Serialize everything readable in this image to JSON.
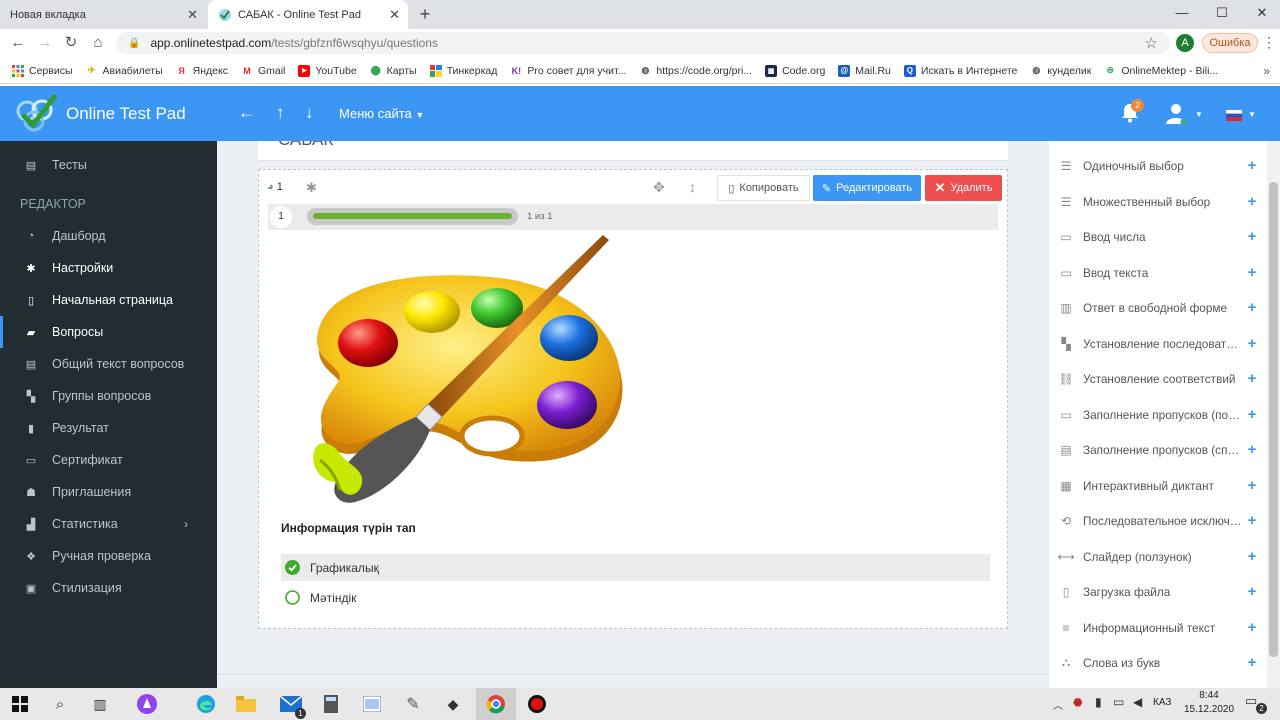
{
  "browser": {
    "tabs": [
      {
        "title": "Новая вкладка",
        "active": false
      },
      {
        "title": "САБАК - Online Test Pad",
        "active": true
      }
    ],
    "url_host": "app.onlinetestpad.com",
    "url_path": "/tests/gbfznf6wsqhyu/questions",
    "profile_initial": "A",
    "error_label": "Ошибка",
    "bookmarks": [
      {
        "label": "Сервисы",
        "icon": "apps-icon"
      },
      {
        "label": "Авиабилеты",
        "icon": "plane-icon"
      },
      {
        "label": "Яндекс",
        "icon": "yandex-icon"
      },
      {
        "label": "Gmail",
        "icon": "gmail-icon"
      },
      {
        "label": "YouTube",
        "icon": "youtube-icon"
      },
      {
        "label": "Карты",
        "icon": "maps-icon"
      },
      {
        "label": "Тинкеркад",
        "icon": "tinkercad-icon"
      },
      {
        "label": "Pro совет для учит...",
        "icon": "k-icon"
      },
      {
        "label": "https://code.org/pri...",
        "icon": "globe-icon"
      },
      {
        "label": "Code.org",
        "icon": "codeorg-icon"
      },
      {
        "label": "Mail.Ru",
        "icon": "mailru-icon"
      },
      {
        "label": "Искать в Интернете",
        "icon": "search-web-icon"
      },
      {
        "label": "кунделик",
        "icon": "globe-icon"
      },
      {
        "label": "OnlineMektep - Bili...",
        "icon": "onlinemektep-icon"
      }
    ]
  },
  "app": {
    "title": "Online Test Pad",
    "site_menu": "Меню сайта",
    "notifications_count": "2",
    "accent": "#3b96f4"
  },
  "sidebar": {
    "top_item": "Тесты",
    "section_label": "РЕДАКТОР",
    "items": [
      {
        "label": "Дашборд"
      },
      {
        "label": "Настройки"
      },
      {
        "label": "Начальная страница"
      },
      {
        "label": "Вопросы"
      },
      {
        "label": "Общий текст вопросов"
      },
      {
        "label": "Группы вопросов"
      },
      {
        "label": "Результат"
      },
      {
        "label": "Сертификат"
      },
      {
        "label": "Приглашения"
      },
      {
        "label": "Статистика"
      },
      {
        "label": "Ручная проверка"
      },
      {
        "label": "Стилизация"
      }
    ]
  },
  "main": {
    "test_title": "САБАК",
    "question_weight": "1",
    "copy_label": "Копировать",
    "edit_label": "Редактировать",
    "delete_label": "Удалить",
    "question_number": "1",
    "progress_text": "1 из 1",
    "progress_fraction": 1.0,
    "question_text": "Информация түрін тап",
    "answers": [
      {
        "text": "Графикалық",
        "correct": true
      },
      {
        "text": "Мәтіндік",
        "correct": false
      }
    ]
  },
  "question_types": [
    {
      "label": "Одиночный выбор"
    },
    {
      "label": "Множественный выбор"
    },
    {
      "label": "Ввод числа"
    },
    {
      "label": "Ввод текста"
    },
    {
      "label": "Ответ в свободной форме"
    },
    {
      "label": "Установление последоват…"
    },
    {
      "label": "Установление соответствий"
    },
    {
      "label": "Заполнение пропусков (по…"
    },
    {
      "label": "Заполнение пропусков (сп…"
    },
    {
      "label": "Интерактивный диктант"
    },
    {
      "label": "Последовательное исключ…"
    },
    {
      "label": "Слайдер (ползунок)"
    },
    {
      "label": "Загрузка файла"
    },
    {
      "label": "Информационный текст"
    },
    {
      "label": "Слова из букв"
    }
  ],
  "taskbar": {
    "time": "8:44",
    "date": "15.12.2020",
    "language": "КАЗ",
    "mail_badge": "1",
    "notification_badge": "2"
  }
}
